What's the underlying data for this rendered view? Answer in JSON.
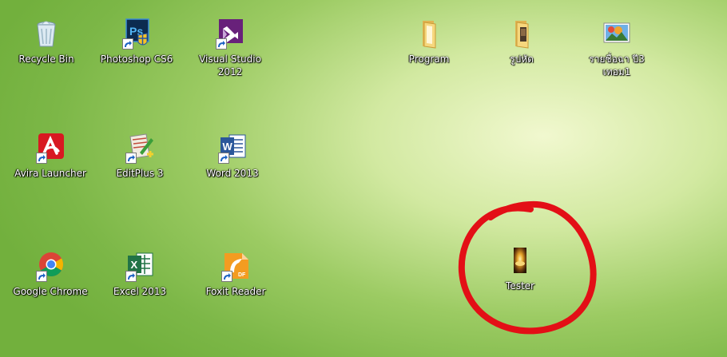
{
  "desktop": {
    "icons": [
      {
        "label": "Recycle Bin",
        "icon": "recycle-bin-icon"
      },
      {
        "label": "Photoshop CS6",
        "icon": "photoshop-icon"
      },
      {
        "label": "Visual Studio 2012",
        "icon": "visual-studio-icon"
      },
      {
        "label": "Program",
        "icon": "folder-icon"
      },
      {
        "label": "รูปหัด",
        "icon": "folder-icon"
      },
      {
        "label": "รายชื่อฉา ปี3 เทอม1",
        "icon": "image-file-icon"
      },
      {
        "label": "Avira Launcher",
        "icon": "avira-icon"
      },
      {
        "label": "EditPlus 3",
        "icon": "editplus-icon"
      },
      {
        "label": "Word 2013",
        "icon": "word-icon"
      },
      {
        "label": "Google Chrome",
        "icon": "chrome-icon"
      },
      {
        "label": "Excel 2013",
        "icon": "excel-icon"
      },
      {
        "label": "Foxit Reader",
        "icon": "foxit-icon"
      },
      {
        "label": "Tester",
        "icon": "tester-app-icon"
      }
    ],
    "annotation": {
      "shape": "hand-drawn circle",
      "color": "#e30f16"
    },
    "colors": {
      "wallpaper": "#8cc252",
      "label": "#ffffff"
    }
  }
}
